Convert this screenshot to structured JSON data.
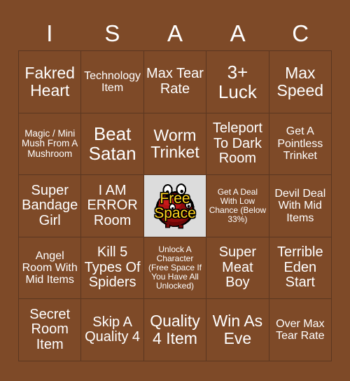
{
  "card": {
    "background_color": "#7e4a28",
    "border_color": "#5a3620",
    "text_color": "#ffffff",
    "header_letters": [
      "I",
      "S",
      "A",
      "A",
      "C"
    ]
  },
  "free_space": {
    "label_line1": "Free",
    "label_line2": "Space",
    "text_color": "#ffd21e",
    "background_color": "#dcdcdc",
    "icon": "red-blob-monster-icon"
  },
  "grid": {
    "columns": 5,
    "rows": 5,
    "cells": [
      {
        "text": "Fakred Heart",
        "size": "lg"
      },
      {
        "text": "Technology Item",
        "size": "sm"
      },
      {
        "text": "Max Tear Rate",
        "size": "md"
      },
      {
        "text": "3+ Luck",
        "size": "xl"
      },
      {
        "text": "Max Speed",
        "size": "lg"
      },
      {
        "text": "Magic / Mini Mush From A Mushroom",
        "size": "xs"
      },
      {
        "text": "Beat Satan",
        "size": "xl"
      },
      {
        "text": "Worm Trinket",
        "size": "lg"
      },
      {
        "text": "Teleport To Dark Room",
        "size": "md"
      },
      {
        "text": "Get A Pointless Trinket",
        "size": "sm"
      },
      {
        "text": "Super Bandage Girl",
        "size": "md"
      },
      {
        "text": "I AM ERROR Room",
        "size": "md"
      },
      {
        "text": "FREE_SPACE",
        "size": "free"
      },
      {
        "text": "Get A Deal With Low Chance (Below 33%)",
        "size": "xxs"
      },
      {
        "text": "Devil Deal With Mid Items",
        "size": "sm"
      },
      {
        "text": "Angel Room With Mid Items",
        "size": "sm"
      },
      {
        "text": "Kill 5 Types Of Spiders",
        "size": "md"
      },
      {
        "text": "Unlock A Character (Free Space If You Have All Unlocked)",
        "size": "xxs"
      },
      {
        "text": "Super Meat Boy",
        "size": "md"
      },
      {
        "text": "Terrible Eden Start",
        "size": "md"
      },
      {
        "text": "Secret Room Item",
        "size": "md"
      },
      {
        "text": "Skip A Quality 4",
        "size": "md"
      },
      {
        "text": "Quality 4 Item",
        "size": "lg"
      },
      {
        "text": "Win As Eve",
        "size": "lg"
      },
      {
        "text": "Over Max Tear Rate",
        "size": "sm"
      }
    ]
  }
}
